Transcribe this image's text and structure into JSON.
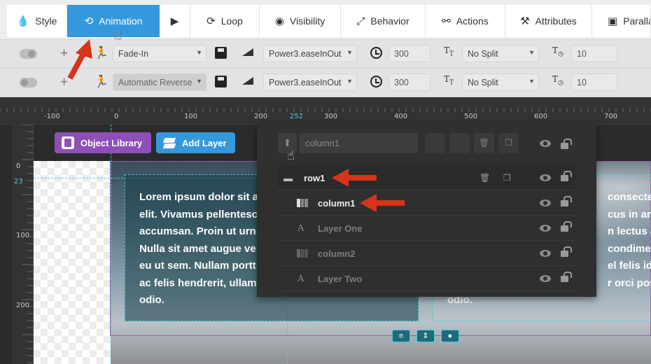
{
  "tabs": [
    {
      "label": "Style",
      "icon": "droplet-icon"
    },
    {
      "label": "Animation",
      "icon": "history-icon"
    },
    {
      "label": "",
      "icon": "play-icon"
    },
    {
      "label": "Loop",
      "icon": "loop-icon"
    },
    {
      "label": "Visibility",
      "icon": "eye-icon"
    },
    {
      "label": "Behavior",
      "icon": "expand-icon"
    },
    {
      "label": "Actions",
      "icon": "link-icon"
    },
    {
      "label": "Attributes",
      "icon": "tools-icon"
    },
    {
      "label": "Paralla",
      "icon": "image-icon"
    }
  ],
  "anim_rows": [
    {
      "effect": "Fade-In",
      "easing": "Power3.easeInOut",
      "duration": "300",
      "split": "No Split",
      "split_delay": "10"
    },
    {
      "effect": "Automatic Reverse",
      "easing": "Power3.easeInOut",
      "duration": "300",
      "split": "No Split",
      "split_delay": "10"
    }
  ],
  "ruler_h": [
    "-100",
    "0",
    "100",
    "200",
    "252",
    "300",
    "400",
    "500",
    "600",
    "700"
  ],
  "ruler_v": [
    "0",
    "23",
    "100",
    "200"
  ],
  "buttons": {
    "object_library": "Object Library",
    "add_layer": "Add Layer"
  },
  "layers_panel": {
    "name_value": "column1",
    "rows": [
      {
        "label": "row1",
        "type": "row"
      },
      {
        "label": "column1",
        "type": "column"
      },
      {
        "label": "Layer One",
        "type": "text"
      },
      {
        "label": "column2",
        "type": "column"
      },
      {
        "label": "Layer Two",
        "type": "text"
      }
    ]
  },
  "canvas_text": {
    "left_lines": [
      "Lorem ipsum dolor sit a",
      "elit. Vivamus pellentesc",
      "accumsan. Proin ut urn",
      "Nulla sit amet augue ve",
      "eu ut sem. Nullam portt",
      "ac felis hendrerit, ullam",
      "odio."
    ],
    "right_lines": [
      "consectetu",
      "cus in ante f",
      "n lectus auct",
      "condimentu",
      "el felis id va",
      "r orci posue",
      "odio."
    ]
  },
  "colors": {
    "accent": "#3598dc",
    "library": "#8e50b8",
    "guide": "#45c8d8",
    "arrow": "#d7341c"
  }
}
